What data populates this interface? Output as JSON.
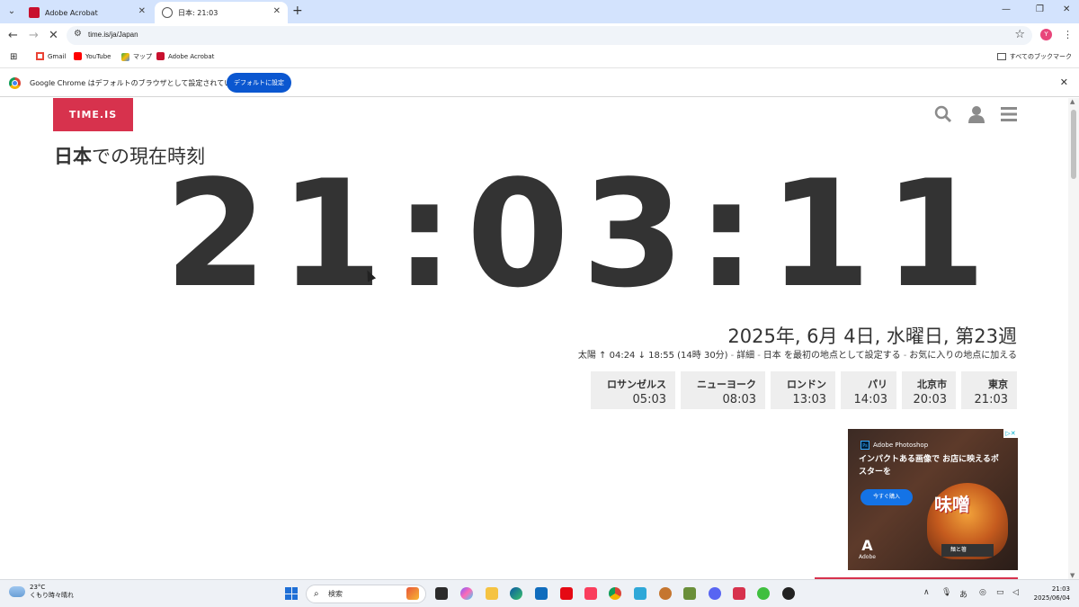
{
  "browser": {
    "tabs": [
      {
        "label": "Adobe Acrobat",
        "active": false
      },
      {
        "label": "日本: 21:03",
        "active": true
      }
    ],
    "url": "time.is/ja/Japan",
    "bookmarks": [
      "Gmail",
      "YouTube",
      "マップ",
      "Adobe Acrobat"
    ],
    "all_bookmarks": "すべてのブックマーク",
    "infobar": {
      "message": "Google Chrome はデフォルトのブラウザとして設定されていません",
      "button": "デフォルトに設定"
    },
    "profile_initial": "Y"
  },
  "site": {
    "logo": "TIME.IS",
    "title_bold": "日本",
    "title_rest": "での現在時刻",
    "clock": "21:03:11",
    "date": "2025年, 6月 4日, 水曜日, 第23週",
    "sun": {
      "text": "太陽 ↑ 04:24 ↓ 18:55 (14時 30分)",
      "details": "詳細",
      "set_home": "日本 を最初の地点として設定する",
      "add_fav": "お気に入りの地点に加える"
    },
    "cities": [
      {
        "name": "ロサンゼルス",
        "time": "05:03"
      },
      {
        "name": "ニューヨーク",
        "time": "08:03"
      },
      {
        "name": "ロンドン",
        "time": "13:03"
      },
      {
        "name": "パリ",
        "time": "14:03"
      },
      {
        "name": "北京市",
        "time": "20:03"
      },
      {
        "name": "東京",
        "time": "21:03"
      }
    ],
    "ad": {
      "brand": "Adobe Photoshop",
      "headline": "インパクトある画像で お店に映えるポスターを",
      "cta": "今すぐ購入",
      "image_text": "味噌",
      "label": "麺と箸",
      "footer": "Adobe"
    }
  },
  "taskbar": {
    "weather_temp": "23°C",
    "weather_cond": "くもり時々晴れ",
    "search_placeholder": "検索",
    "ime": "あ",
    "time": "21:03",
    "date": "2025/06/04"
  },
  "colors": {
    "brand_red": "#d7324d",
    "clock_text": "#333333",
    "chrome_blue": "#0b57d0",
    "tab_strip": "#d3e3fd"
  }
}
